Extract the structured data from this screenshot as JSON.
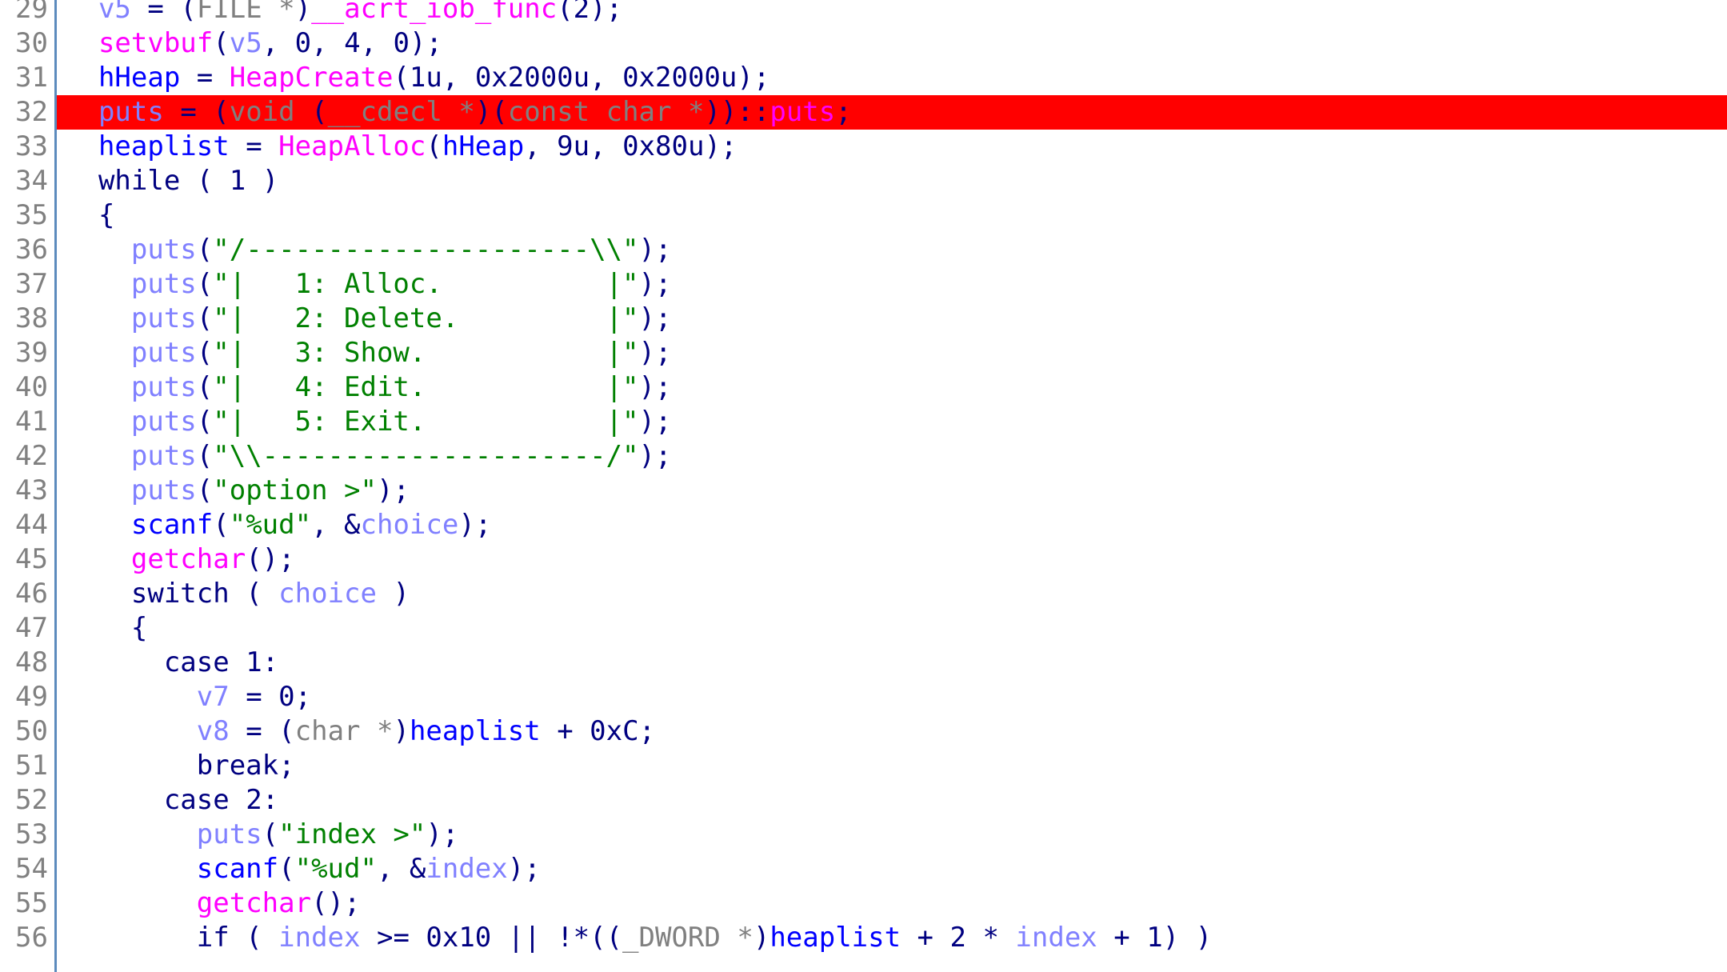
{
  "app": {
    "name": "hex-rays-pseudocode-view",
    "theme": "light"
  },
  "colors": {
    "background": "#ffffff",
    "line_number": "#808080",
    "separator": "#5c8bbd",
    "highlight_row": "#ff0000",
    "keyword": "#000080",
    "function": "#ff00ff",
    "local_var": "#8080ff",
    "global_var": "#0000ff",
    "string": "#008000",
    "type_cast": "#808080"
  },
  "editor": {
    "current_line": 32,
    "first_visible_line": 29,
    "last_visible_line": 56,
    "breakpoint_marker_line": 32
  },
  "lines": [
    {
      "n": "29",
      "hl": false,
      "clipped": true,
      "tokens": [
        {
          "t": "  ",
          "c": "pun"
        },
        {
          "t": "v5",
          "c": "loc"
        },
        {
          "t": " = ",
          "c": "pun"
        },
        {
          "t": "(",
          "c": "pun"
        },
        {
          "t": "FILE ",
          "c": "typ"
        },
        {
          "t": "*",
          "c": "typ"
        },
        {
          "t": ")",
          "c": "pun"
        },
        {
          "t": "__acrt_iob_func",
          "c": "fn"
        },
        {
          "t": "(",
          "c": "pun"
        },
        {
          "t": "2",
          "c": "num2"
        },
        {
          "t": ");",
          "c": "pun"
        }
      ]
    },
    {
      "n": "30",
      "hl": false,
      "tokens": [
        {
          "t": "  ",
          "c": "pun"
        },
        {
          "t": "setvbuf",
          "c": "fn"
        },
        {
          "t": "(",
          "c": "pun"
        },
        {
          "t": "v5",
          "c": "loc"
        },
        {
          "t": ", ",
          "c": "pun"
        },
        {
          "t": "0",
          "c": "num2"
        },
        {
          "t": ", ",
          "c": "pun"
        },
        {
          "t": "4",
          "c": "num2"
        },
        {
          "t": ", ",
          "c": "pun"
        },
        {
          "t": "0",
          "c": "num2"
        },
        {
          "t": ");",
          "c": "pun"
        }
      ]
    },
    {
      "n": "31",
      "hl": false,
      "tokens": [
        {
          "t": "  ",
          "c": "pun"
        },
        {
          "t": "hHeap",
          "c": "glb"
        },
        {
          "t": " = ",
          "c": "pun"
        },
        {
          "t": "HeapCreate",
          "c": "fn"
        },
        {
          "t": "(",
          "c": "pun"
        },
        {
          "t": "1u",
          "c": "num2"
        },
        {
          "t": ", ",
          "c": "pun"
        },
        {
          "t": "0x2000u",
          "c": "num2"
        },
        {
          "t": ", ",
          "c": "pun"
        },
        {
          "t": "0x2000u",
          "c": "num2"
        },
        {
          "t": ");",
          "c": "pun"
        }
      ]
    },
    {
      "n": "32",
      "hl": true,
      "tokens": [
        {
          "t": "  ",
          "c": "pun"
        },
        {
          "t": "puts",
          "c": "loc"
        },
        {
          "t": " = ",
          "c": "pun"
        },
        {
          "t": "(",
          "c": "pun"
        },
        {
          "t": "void ",
          "c": "typ"
        },
        {
          "t": "(",
          "c": "pun"
        },
        {
          "t": "__cdecl ",
          "c": "typ"
        },
        {
          "t": "*",
          "c": "typ"
        },
        {
          "t": ")(",
          "c": "pun"
        },
        {
          "t": "const char ",
          "c": "typ"
        },
        {
          "t": "*",
          "c": "typ"
        },
        {
          "t": "))",
          "c": "pun"
        },
        {
          "t": "::",
          "c": "pun"
        },
        {
          "t": "puts",
          "c": "fn"
        },
        {
          "t": ";",
          "c": "pun"
        }
      ]
    },
    {
      "n": "33",
      "hl": false,
      "tokens": [
        {
          "t": "  ",
          "c": "pun"
        },
        {
          "t": "heaplist",
          "c": "glb"
        },
        {
          "t": " = ",
          "c": "pun"
        },
        {
          "t": "HeapAlloc",
          "c": "fn"
        },
        {
          "t": "(",
          "c": "pun"
        },
        {
          "t": "hHeap",
          "c": "glb"
        },
        {
          "t": ", ",
          "c": "pun"
        },
        {
          "t": "9u",
          "c": "num2"
        },
        {
          "t": ", ",
          "c": "pun"
        },
        {
          "t": "0x80u",
          "c": "num2"
        },
        {
          "t": ");",
          "c": "pun"
        }
      ]
    },
    {
      "n": "34",
      "hl": false,
      "tokens": [
        {
          "t": "  ",
          "c": "pun"
        },
        {
          "t": "while",
          "c": "kw"
        },
        {
          "t": " ( ",
          "c": "pun"
        },
        {
          "t": "1",
          "c": "num2"
        },
        {
          "t": " )",
          "c": "pun"
        }
      ]
    },
    {
      "n": "35",
      "hl": false,
      "tokens": [
        {
          "t": "  {",
          "c": "pun"
        }
      ]
    },
    {
      "n": "36",
      "hl": false,
      "tokens": [
        {
          "t": "    ",
          "c": "pun"
        },
        {
          "t": "puts",
          "c": "loc"
        },
        {
          "t": "(",
          "c": "pun"
        },
        {
          "t": "\"/---------------------\\\\\"",
          "c": "str"
        },
        {
          "t": ");",
          "c": "pun"
        }
      ]
    },
    {
      "n": "37",
      "hl": false,
      "tokens": [
        {
          "t": "    ",
          "c": "pun"
        },
        {
          "t": "puts",
          "c": "loc"
        },
        {
          "t": "(",
          "c": "pun"
        },
        {
          "t": "\"|   1: Alloc.          |\"",
          "c": "str"
        },
        {
          "t": ");",
          "c": "pun"
        }
      ]
    },
    {
      "n": "38",
      "hl": false,
      "tokens": [
        {
          "t": "    ",
          "c": "pun"
        },
        {
          "t": "puts",
          "c": "loc"
        },
        {
          "t": "(",
          "c": "pun"
        },
        {
          "t": "\"|   2: Delete.         |\"",
          "c": "str"
        },
        {
          "t": ");",
          "c": "pun"
        }
      ]
    },
    {
      "n": "39",
      "hl": false,
      "tokens": [
        {
          "t": "    ",
          "c": "pun"
        },
        {
          "t": "puts",
          "c": "loc"
        },
        {
          "t": "(",
          "c": "pun"
        },
        {
          "t": "\"|   3: Show.           |\"",
          "c": "str"
        },
        {
          "t": ");",
          "c": "pun"
        }
      ]
    },
    {
      "n": "40",
      "hl": false,
      "tokens": [
        {
          "t": "    ",
          "c": "pun"
        },
        {
          "t": "puts",
          "c": "loc"
        },
        {
          "t": "(",
          "c": "pun"
        },
        {
          "t": "\"|   4: Edit.           |\"",
          "c": "str"
        },
        {
          "t": ");",
          "c": "pun"
        }
      ]
    },
    {
      "n": "41",
      "hl": false,
      "tokens": [
        {
          "t": "    ",
          "c": "pun"
        },
        {
          "t": "puts",
          "c": "loc"
        },
        {
          "t": "(",
          "c": "pun"
        },
        {
          "t": "\"|   5: Exit.           |\"",
          "c": "str"
        },
        {
          "t": ");",
          "c": "pun"
        }
      ]
    },
    {
      "n": "42",
      "hl": false,
      "tokens": [
        {
          "t": "    ",
          "c": "pun"
        },
        {
          "t": "puts",
          "c": "loc"
        },
        {
          "t": "(",
          "c": "pun"
        },
        {
          "t": "\"\\\\---------------------/\"",
          "c": "str"
        },
        {
          "t": ");",
          "c": "pun"
        }
      ]
    },
    {
      "n": "43",
      "hl": false,
      "tokens": [
        {
          "t": "    ",
          "c": "pun"
        },
        {
          "t": "puts",
          "c": "loc"
        },
        {
          "t": "(",
          "c": "pun"
        },
        {
          "t": "\"option >\"",
          "c": "str"
        },
        {
          "t": ");",
          "c": "pun"
        }
      ]
    },
    {
      "n": "44",
      "hl": false,
      "tokens": [
        {
          "t": "    ",
          "c": "pun"
        },
        {
          "t": "scanf",
          "c": "glb"
        },
        {
          "t": "(",
          "c": "pun"
        },
        {
          "t": "\"%ud\"",
          "c": "str"
        },
        {
          "t": ", &",
          "c": "pun"
        },
        {
          "t": "choice",
          "c": "loc"
        },
        {
          "t": ");",
          "c": "pun"
        }
      ]
    },
    {
      "n": "45",
      "hl": false,
      "tokens": [
        {
          "t": "    ",
          "c": "pun"
        },
        {
          "t": "getchar",
          "c": "fn"
        },
        {
          "t": "();",
          "c": "pun"
        }
      ]
    },
    {
      "n": "46",
      "hl": false,
      "tokens": [
        {
          "t": "    ",
          "c": "pun"
        },
        {
          "t": "switch",
          "c": "kw"
        },
        {
          "t": " ( ",
          "c": "pun"
        },
        {
          "t": "choice",
          "c": "loc"
        },
        {
          "t": " )",
          "c": "pun"
        }
      ]
    },
    {
      "n": "47",
      "hl": false,
      "tokens": [
        {
          "t": "    {",
          "c": "pun"
        }
      ]
    },
    {
      "n": "48",
      "hl": false,
      "tokens": [
        {
          "t": "      ",
          "c": "pun"
        },
        {
          "t": "case",
          "c": "kw"
        },
        {
          "t": " ",
          "c": "pun"
        },
        {
          "t": "1",
          "c": "num2"
        },
        {
          "t": ":",
          "c": "pun"
        }
      ]
    },
    {
      "n": "49",
      "hl": false,
      "tokens": [
        {
          "t": "        ",
          "c": "pun"
        },
        {
          "t": "v7",
          "c": "loc"
        },
        {
          "t": " = ",
          "c": "pun"
        },
        {
          "t": "0",
          "c": "num2"
        },
        {
          "t": ";",
          "c": "pun"
        }
      ]
    },
    {
      "n": "50",
      "hl": false,
      "tokens": [
        {
          "t": "        ",
          "c": "pun"
        },
        {
          "t": "v8",
          "c": "loc"
        },
        {
          "t": " = ",
          "c": "pun"
        },
        {
          "t": "(",
          "c": "pun"
        },
        {
          "t": "char ",
          "c": "typ"
        },
        {
          "t": "*",
          "c": "typ"
        },
        {
          "t": ")",
          "c": "pun"
        },
        {
          "t": "heaplist",
          "c": "glb"
        },
        {
          "t": " + ",
          "c": "pun"
        },
        {
          "t": "0xC",
          "c": "num2"
        },
        {
          "t": ";",
          "c": "pun"
        }
      ]
    },
    {
      "n": "51",
      "hl": false,
      "tokens": [
        {
          "t": "        ",
          "c": "pun"
        },
        {
          "t": "break",
          "c": "kw"
        },
        {
          "t": ";",
          "c": "pun"
        }
      ]
    },
    {
      "n": "52",
      "hl": false,
      "tokens": [
        {
          "t": "      ",
          "c": "pun"
        },
        {
          "t": "case",
          "c": "kw"
        },
        {
          "t": " ",
          "c": "pun"
        },
        {
          "t": "2",
          "c": "num2"
        },
        {
          "t": ":",
          "c": "pun"
        }
      ]
    },
    {
      "n": "53",
      "hl": false,
      "tokens": [
        {
          "t": "        ",
          "c": "pun"
        },
        {
          "t": "puts",
          "c": "loc"
        },
        {
          "t": "(",
          "c": "pun"
        },
        {
          "t": "\"index >\"",
          "c": "str"
        },
        {
          "t": ");",
          "c": "pun"
        }
      ]
    },
    {
      "n": "54",
      "hl": false,
      "tokens": [
        {
          "t": "        ",
          "c": "pun"
        },
        {
          "t": "scanf",
          "c": "glb"
        },
        {
          "t": "(",
          "c": "pun"
        },
        {
          "t": "\"%ud\"",
          "c": "str"
        },
        {
          "t": ", &",
          "c": "pun"
        },
        {
          "t": "index",
          "c": "loc"
        },
        {
          "t": ");",
          "c": "pun"
        }
      ]
    },
    {
      "n": "55",
      "hl": false,
      "tokens": [
        {
          "t": "        ",
          "c": "pun"
        },
        {
          "t": "getchar",
          "c": "fn"
        },
        {
          "t": "();",
          "c": "pun"
        }
      ]
    },
    {
      "n": "56",
      "hl": false,
      "tokens": [
        {
          "t": "        ",
          "c": "pun"
        },
        {
          "t": "if",
          "c": "kw"
        },
        {
          "t": " ( ",
          "c": "pun"
        },
        {
          "t": "index",
          "c": "loc"
        },
        {
          "t": " >= ",
          "c": "pun"
        },
        {
          "t": "0x10",
          "c": "num2"
        },
        {
          "t": " || !*((",
          "c": "pun"
        },
        {
          "t": "_DWORD ",
          "c": "typ"
        },
        {
          "t": "*",
          "c": "typ"
        },
        {
          "t": ")",
          "c": "pun"
        },
        {
          "t": "heaplist",
          "c": "glb"
        },
        {
          "t": " + ",
          "c": "pun"
        },
        {
          "t": "2",
          "c": "num2"
        },
        {
          "t": " * ",
          "c": "pun"
        },
        {
          "t": "index",
          "c": "loc"
        },
        {
          "t": " + ",
          "c": "pun"
        },
        {
          "t": "1",
          "c": "num2"
        },
        {
          "t": ") )",
          "c": "pun"
        }
      ]
    }
  ]
}
